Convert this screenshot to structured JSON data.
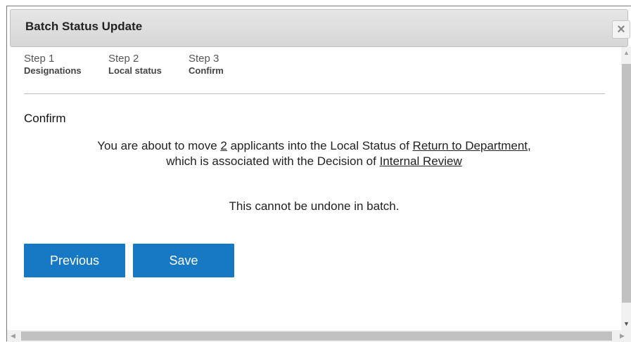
{
  "dialog": {
    "title": "Batch Status Update",
    "close_label": "×"
  },
  "steps": [
    {
      "number": "Step 1",
      "label": "Designations"
    },
    {
      "number": "Step 2",
      "label": "Local status"
    },
    {
      "number": "Step 3",
      "label": "Confirm"
    }
  ],
  "confirm": {
    "heading": "Confirm",
    "line1_prefix": "You are about to move ",
    "count": "2",
    "line1_middle": " applicants into the Local Status of ",
    "local_status": "Return to Department",
    "line1_suffix": ",",
    "line2_prefix": "which is associated with the Decision of ",
    "decision": "Internal Review",
    "warning": "This cannot be undone in batch."
  },
  "buttons": {
    "previous": "Previous",
    "save": "Save"
  },
  "colors": {
    "primary_button": "#1779c4",
    "titlebar": "#dcdcdc"
  }
}
